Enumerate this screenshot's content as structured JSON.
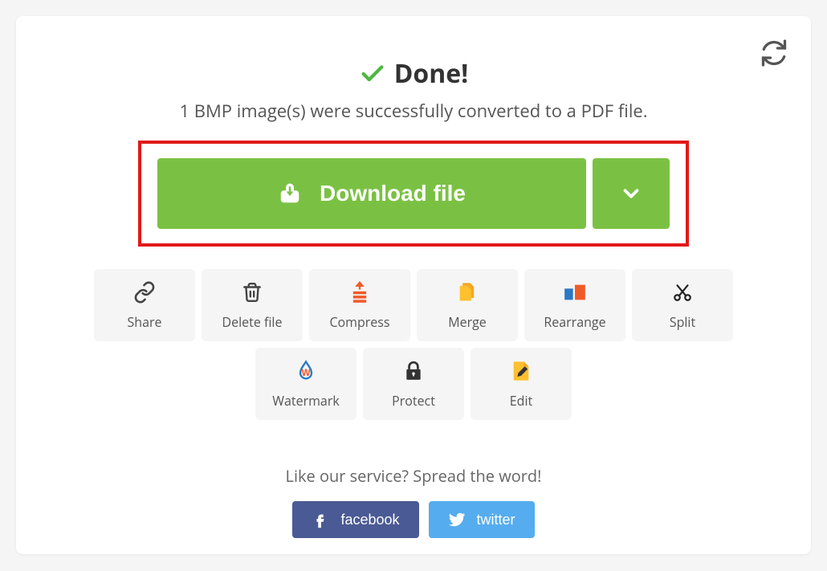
{
  "colors": {
    "success": "#7ac143",
    "highlight": "#e21919",
    "facebook": "#4a5a94",
    "twitter": "#55acee",
    "orange": "#f5a623",
    "ink": "#444"
  },
  "header": {
    "done": "Done!",
    "subtitle": "1 BMP image(s) were successfully converted to a PDF file."
  },
  "download": {
    "label": "Download file"
  },
  "actions": [
    {
      "id": "share",
      "label": "Share",
      "icon": "link"
    },
    {
      "id": "delete",
      "label": "Delete file",
      "icon": "trash"
    },
    {
      "id": "compress",
      "label": "Compress",
      "icon": "compress"
    },
    {
      "id": "merge",
      "label": "Merge",
      "icon": "files"
    },
    {
      "id": "rearrange",
      "label": "Rearrange",
      "icon": "rearrange"
    },
    {
      "id": "split",
      "label": "Split",
      "icon": "scissors"
    },
    {
      "id": "watermark",
      "label": "Watermark",
      "icon": "watermark"
    },
    {
      "id": "protect",
      "label": "Protect",
      "icon": "lock"
    },
    {
      "id": "edit",
      "label": "Edit",
      "icon": "edit"
    }
  ],
  "share": {
    "prompt": "Like our service? Spread the word!",
    "facebook": "facebook",
    "twitter": "twitter"
  }
}
